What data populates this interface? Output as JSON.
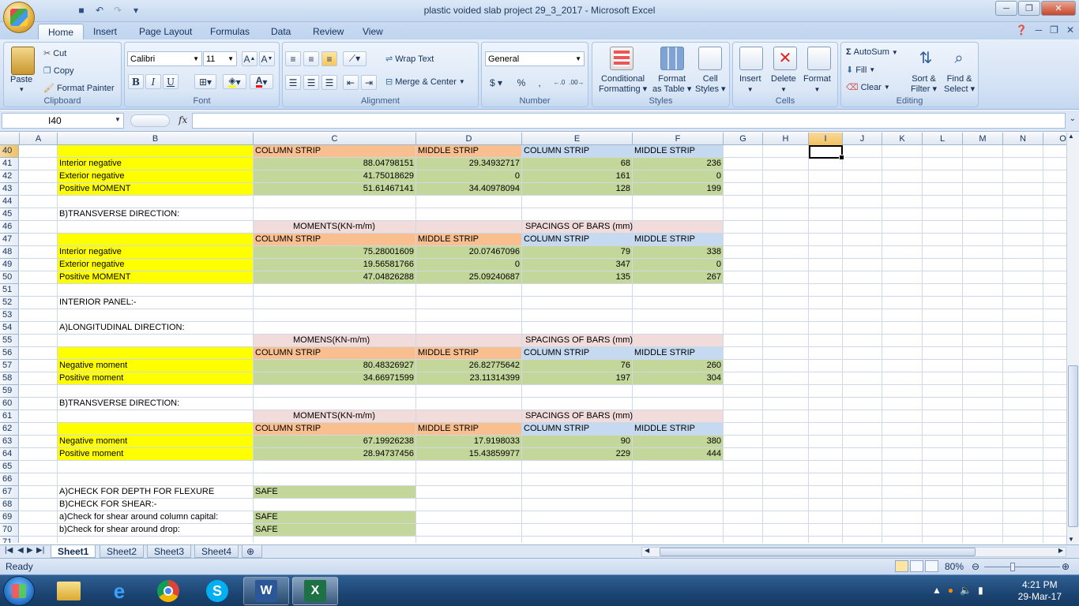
{
  "window": {
    "title": "plastic voided slab project 29_3_2017  -  Microsoft Excel"
  },
  "tabs": [
    "Home",
    "Insert",
    "Page Layout",
    "Formulas",
    "Data",
    "Review",
    "View"
  ],
  "ribbon": {
    "clipboard": {
      "paste": "Paste",
      "cut": "Cut",
      "copy": "Copy",
      "format_painter": "Format Painter",
      "label": "Clipboard"
    },
    "font": {
      "name": "Calibri",
      "size": "11",
      "label": "Font"
    },
    "alignment": {
      "wrap_text": "Wrap Text",
      "merge_center": "Merge & Center",
      "label": "Alignment"
    },
    "number": {
      "format": "General",
      "label": "Number"
    },
    "styles": {
      "conditional": "Conditional",
      "conditional2": "Formatting",
      "format_as": "Format",
      "format_as2": "as Table",
      "cell": "Cell",
      "cell2": "Styles",
      "label": "Styles"
    },
    "cells": {
      "insert": "Insert",
      "delete": "Delete",
      "format": "Format",
      "label": "Cells"
    },
    "editing": {
      "autosum": "AutoSum",
      "fill": "Fill",
      "clear": "Clear",
      "sort": "Sort &",
      "sort2": "Filter",
      "find": "Find &",
      "find2": "Select",
      "label": "Editing"
    }
  },
  "formula_bar": {
    "name_box": "I40",
    "fx": "fx",
    "value": ""
  },
  "columns": [
    "A",
    "B",
    "C",
    "D",
    "E",
    "F",
    "G",
    "H",
    "I",
    "J",
    "K",
    "L",
    "M",
    "N",
    "O"
  ],
  "rows": [
    {
      "n": "40",
      "B": "",
      "C": "COLUMN STRIP",
      "D": "MIDDLE STRIP",
      "E": "COLUMN STRIP",
      "F": "MIDDLE STRIP",
      "style": "hdr"
    },
    {
      "n": "41",
      "B": "Interior negative",
      "C": "88.04798151",
      "D": "29.34932717",
      "E": "68",
      "F": "236",
      "style": "data"
    },
    {
      "n": "42",
      "B": "Exterior negative",
      "C": "41.75018629",
      "D": "0",
      "E": "161",
      "F": "0",
      "style": "data"
    },
    {
      "n": "43",
      "B": "Positive MOMENT",
      "C": "51.61467141",
      "D": "34.40978094",
      "E": "128",
      "F": "199",
      "style": "data"
    },
    {
      "n": "44",
      "style": "blank"
    },
    {
      "n": "45",
      "B": "B)TRANSVERSE DIRECTION:",
      "style": "text"
    },
    {
      "n": "46",
      "C": "MOMENTS(KN-m/m)",
      "E": "SPACINGS OF BARS  (mm)",
      "style": "title"
    },
    {
      "n": "47",
      "B": "",
      "C": "COLUMN STRIP",
      "D": "MIDDLE STRIP",
      "E": "COLUMN STRIP",
      "F": "MIDDLE STRIP",
      "style": "hdr"
    },
    {
      "n": "48",
      "B": "Interior negative",
      "C": "75.28001609",
      "D": "20.07467096",
      "E": "79",
      "F": "338",
      "style": "data"
    },
    {
      "n": "49",
      "B": "Exterior negative",
      "C": "19.56581766",
      "D": "0",
      "E": "347",
      "F": "0",
      "style": "data"
    },
    {
      "n": "50",
      "B": "Positive MOMENT",
      "C": "47.04826288",
      "D": "25.09240687",
      "E": "135",
      "F": "267",
      "style": "data"
    },
    {
      "n": "51",
      "style": "blank"
    },
    {
      "n": "52",
      "B": "INTERIOR PANEL:-",
      "style": "text"
    },
    {
      "n": "53",
      "style": "blank"
    },
    {
      "n": "54",
      "B": "A)LONGITUDINAL DIRECTION:",
      "style": "text"
    },
    {
      "n": "55",
      "C": "MOMENS(KN-m/m)",
      "E": "SPACINGS OF BARS (mm)",
      "style": "title"
    },
    {
      "n": "56",
      "B": "",
      "C": "COLUMN STRIP",
      "D": "MIDDLE STRIP",
      "E": "COLUMN STRIP",
      "F": "MIDDLE STRIP",
      "style": "hdr"
    },
    {
      "n": "57",
      "B": "Negative moment",
      "C": "80.48326927",
      "D": "26.82775642",
      "E": "76",
      "F": "260",
      "style": "data"
    },
    {
      "n": "58",
      "B": "Positive moment",
      "C": "34.66971599",
      "D": "23.11314399",
      "E": "197",
      "F": "304",
      "style": "data"
    },
    {
      "n": "59",
      "style": "blank"
    },
    {
      "n": "60",
      "B": "B)TRANSVERSE DIRECTION:",
      "style": "text"
    },
    {
      "n": "61",
      "C": "MOMENTS(KN-m/m)",
      "E": "SPACINGS OF BARS (mm)",
      "style": "title"
    },
    {
      "n": "62",
      "B": "",
      "C": "COLUMN STRIP",
      "D": "MIDDLE STRIP",
      "E": "COLUMN STRIP",
      "F": "MIDDLE STRIP",
      "style": "hdr"
    },
    {
      "n": "63",
      "B": "Negative moment",
      "C": "67.19926238",
      "D": "17.9198033",
      "E": "90",
      "F": "380",
      "style": "data"
    },
    {
      "n": "64",
      "B": "Positive moment",
      "C": "28.94737456",
      "D": "15.43859977",
      "E": "229",
      "F": "444",
      "style": "data"
    },
    {
      "n": "65",
      "style": "blank"
    },
    {
      "n": "66",
      "style": "blank"
    },
    {
      "n": "67",
      "B": "A)CHECK FOR DEPTH FOR FLEXURE",
      "C": "SAFE",
      "style": "check"
    },
    {
      "n": "68",
      "B": "B)CHECK FOR SHEAR:-",
      "C": "",
      "style": "plain"
    },
    {
      "n": "69",
      "B": "a)Check for shear around column capital:",
      "C": "SAFE",
      "style": "check"
    },
    {
      "n": "70",
      "B": "b)Check for shear around drop:",
      "C": "SAFE",
      "style": "check"
    },
    {
      "n": "71",
      "style": "blank"
    }
  ],
  "sheets": [
    "Sheet1",
    "Sheet2",
    "Sheet3",
    "Sheet4"
  ],
  "status": {
    "text": "Ready",
    "zoom": "80%"
  },
  "clock": {
    "time": "4:21 PM",
    "date": "29-Mar-17"
  }
}
